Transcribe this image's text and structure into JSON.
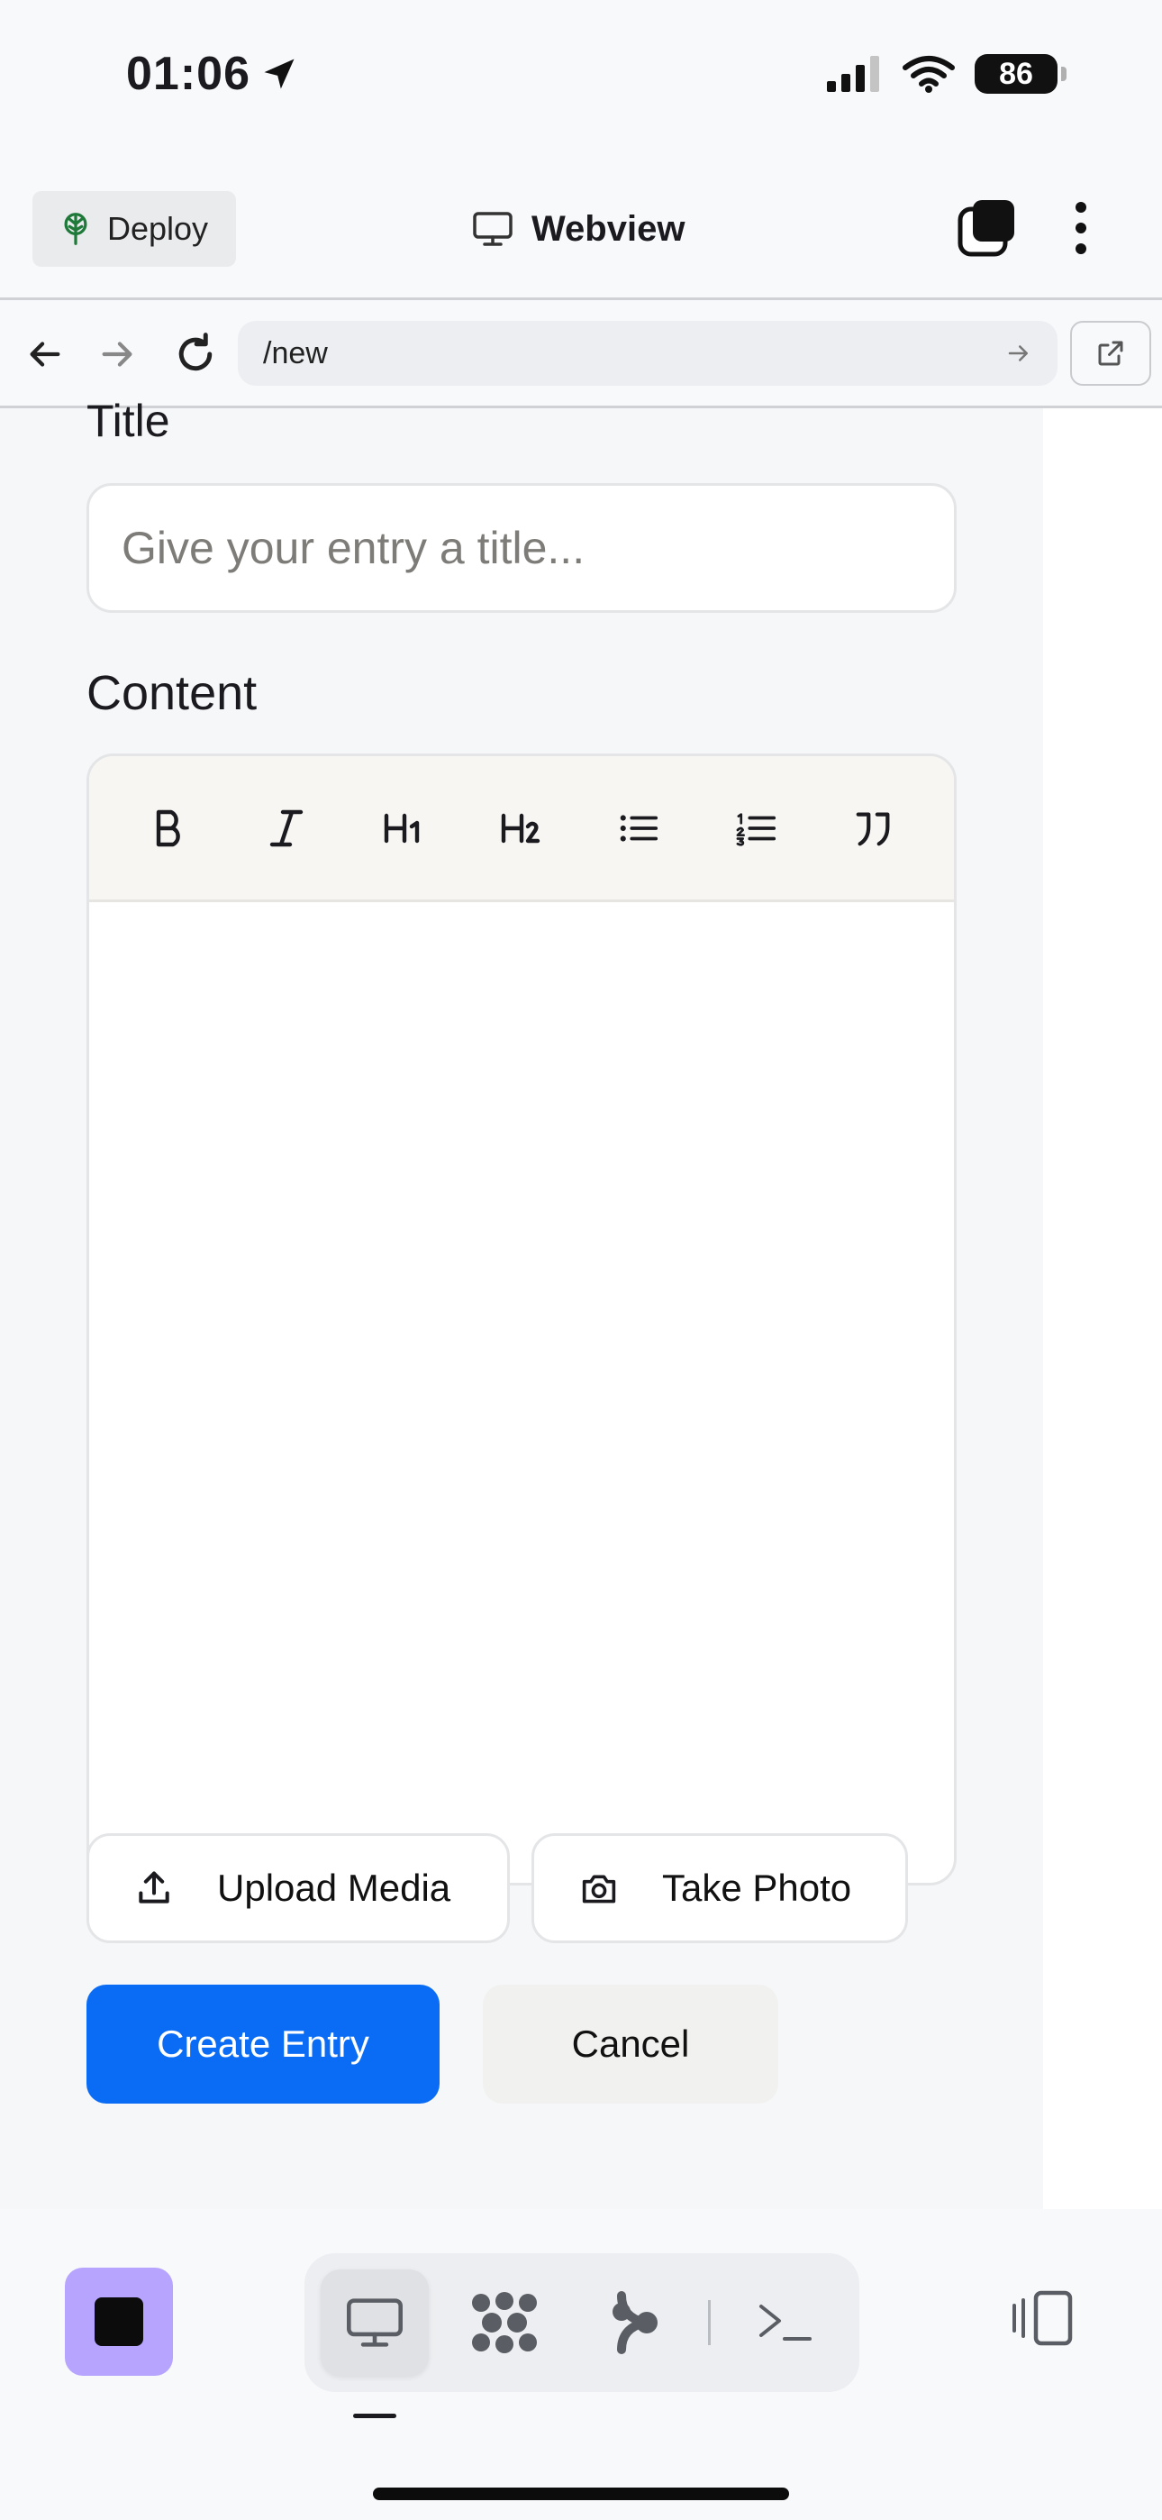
{
  "status_bar": {
    "time": "01:06",
    "battery": "86"
  },
  "header": {
    "deploy_label": "Deploy",
    "title": "Webview"
  },
  "url_bar": {
    "url": "/new"
  },
  "form": {
    "title_label": "Title",
    "title_placeholder": "Give your entry a title...",
    "content_label": "Content",
    "toolbar": [
      "B",
      "I",
      "H1",
      "H2",
      "bullet-list",
      "numbered-list",
      "quote"
    ],
    "upload_label": "Upload Media",
    "photo_label": "Take Photo",
    "create_label": "Create Entry",
    "cancel_label": "Cancel"
  },
  "dock": {
    "items": [
      "monitor-icon",
      "grid-dots-icon",
      "branch-icon",
      "terminal-icon"
    ],
    "active": "monitor-icon"
  },
  "colors": {
    "primary": "#0a6cf5",
    "stop": "#b7a4ff"
  }
}
